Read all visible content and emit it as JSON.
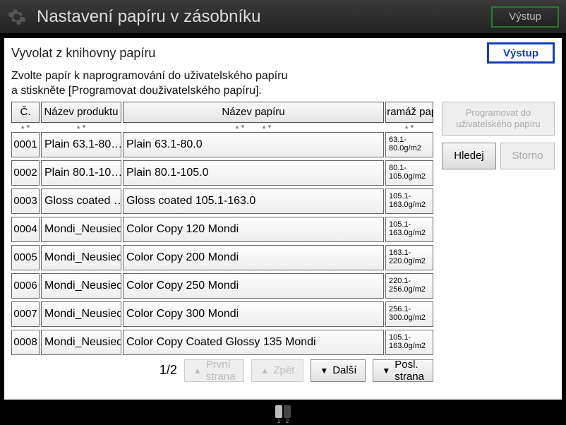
{
  "titlebar": {
    "title": "Nastavení papíru v zásobníku",
    "out": "Výstup"
  },
  "subhead": {
    "title": "Vyvolat z knihovny papíru",
    "out": "Výstup"
  },
  "instructions": {
    "line1": "Zvolte papír k naprogramování do uživatelského papíru",
    "line2": "a stiskněte [Programovat douživatelského papíru]."
  },
  "columns": {
    "num": "Č.",
    "product": "Název produktu",
    "name": "Název papíru",
    "weight": "Gramáž pap."
  },
  "rows": [
    {
      "num": "0001",
      "product": "Plain 63.1-80…",
      "name": "Plain 63.1-80.0",
      "wt1": "63.1-",
      "wt2": "80.0g/m2"
    },
    {
      "num": "0002",
      "product": "Plain 80.1-10…",
      "name": "Plain 80.1-105.0",
      "wt1": "80.1-",
      "wt2": "105.0g/m2"
    },
    {
      "num": "0003",
      "product": "Gloss coated …",
      "name": "Gloss coated 105.1-163.0",
      "wt1": "105.1-",
      "wt2": "163.0g/m2"
    },
    {
      "num": "0004",
      "product": "Mondi_Neusied…",
      "name": "Color Copy 120 Mondi",
      "wt1": "105.1-",
      "wt2": "163.0g/m2"
    },
    {
      "num": "0005",
      "product": "Mondi_Neusied…",
      "name": "Color Copy 200 Mondi",
      "wt1": "163.1-",
      "wt2": "220.0g/m2"
    },
    {
      "num": "0006",
      "product": "Mondi_Neusied…",
      "name": "Color Copy 250 Mondi",
      "wt1": "220.1-",
      "wt2": "256.0g/m2"
    },
    {
      "num": "0007",
      "product": "Mondi_Neusied…",
      "name": "Color Copy 300 Mondi",
      "wt1": "256.1-",
      "wt2": "300.0g/m2"
    },
    {
      "num": "0008",
      "product": "Mondi_Neusied…",
      "name": "Color Copy Coated Glossy 135 Mondi",
      "wt1": "105.1-",
      "wt2": "163.0g/m2"
    }
  ],
  "side": {
    "program1": "Programovat do",
    "program2": "uživatelského papíru",
    "search": "Hledej",
    "cancel": "Storno"
  },
  "pager": {
    "page": "1/2",
    "first": "První strana",
    "back": "Zpět",
    "next": "Další",
    "last": "Posl. strana"
  },
  "trays": {
    "t1": "1",
    "t2": "2"
  }
}
